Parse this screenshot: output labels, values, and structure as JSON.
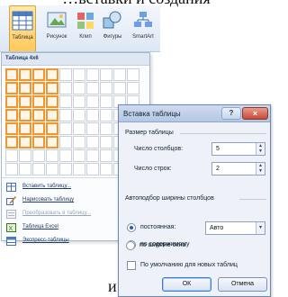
{
  "page": {
    "top_text": "…вставки и создания",
    "bottom_text": "и"
  },
  "ribbon": {
    "buttons": [
      {
        "label": "Таблица",
        "icon": "table-icon"
      },
      {
        "label": "Рисунок",
        "icon": "picture-icon"
      },
      {
        "label": "Клип",
        "icon": "clipart-icon"
      },
      {
        "label": "Фигуры",
        "icon": "shapes-icon"
      },
      {
        "label": "SmartArt",
        "icon": "smartart-icon"
      }
    ]
  },
  "dropdown": {
    "header": "Таблица 4x6",
    "grid": {
      "columns": 10,
      "rows": 8,
      "selected_columns": 4,
      "selected_rows": 6
    },
    "items": [
      {
        "label": "Вставить таблицу...",
        "icon": "insert-table-icon",
        "enabled": true
      },
      {
        "label": "Нарисовать таблицу",
        "icon": "draw-table-icon",
        "enabled": true
      },
      {
        "label": "Преобразовать в таблицу...",
        "icon": "convert-table-icon",
        "enabled": false
      },
      {
        "label": "Таблица Excel",
        "icon": "excel-table-icon",
        "enabled": true
      },
      {
        "label": "Экспресс-таблицы",
        "icon": "quick-tables-icon",
        "enabled": true
      }
    ]
  },
  "dialog": {
    "title": "Вставка таблицы",
    "help": "?",
    "close": "×",
    "size_section": "Размер таблицы",
    "columns_label": "Число столбцов:",
    "columns_value": "5",
    "rows_label": "Число строк:",
    "rows_value": "2",
    "autofit_section": "Автоподбор ширины столбцов",
    "radio_fixed": "постоянная:",
    "fixed_value": "Авто",
    "radio_content": "по содержимому",
    "radio_window": "по ширине окна",
    "checkbox_default": "По умолчанию для новых таблиц",
    "ok": "ОК",
    "cancel": "Отмена"
  },
  "colors": {
    "accent": "#f4942a",
    "dialog_title": "#b4c7e3",
    "close_button": "#c64a36"
  }
}
